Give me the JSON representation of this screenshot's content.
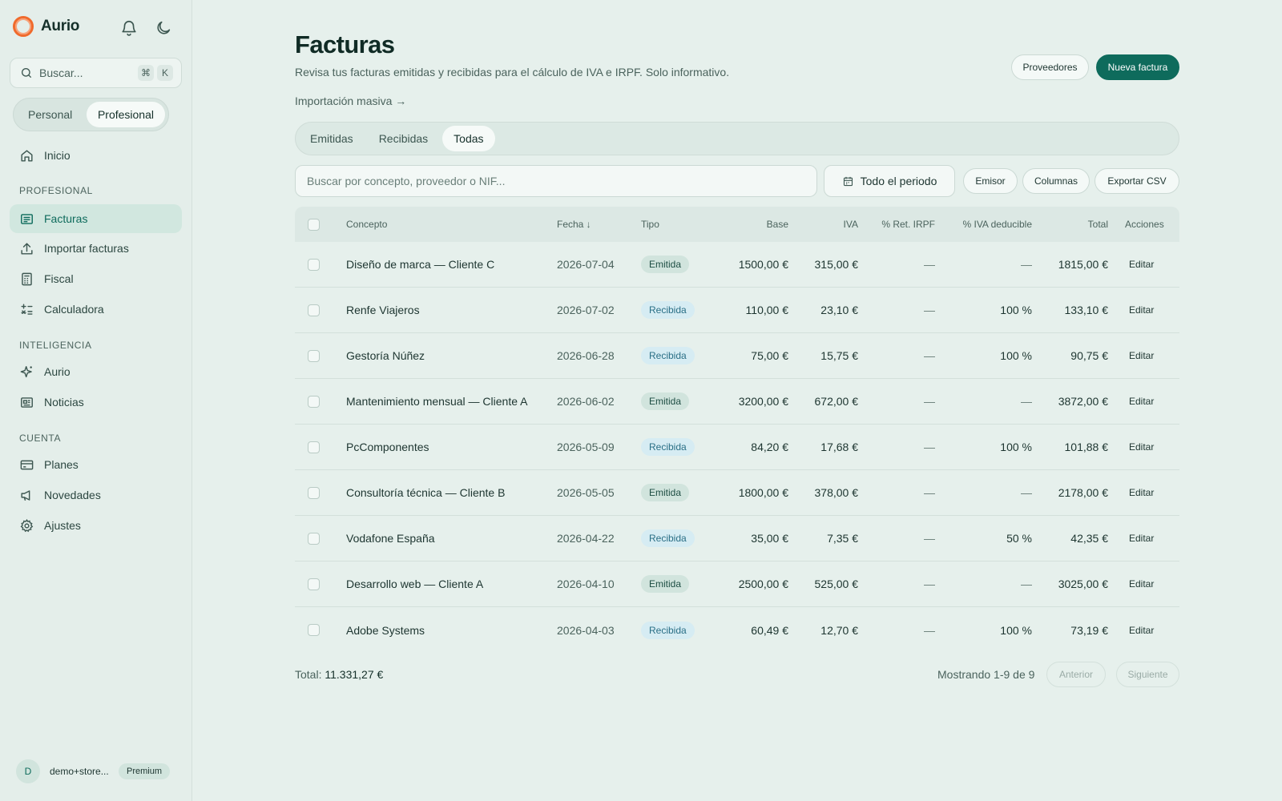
{
  "sidebar": {
    "brand": "Aurio",
    "search": {
      "placeholder": "Buscar...",
      "keys": [
        "⌘",
        "K"
      ]
    },
    "mode": {
      "options": [
        "Personal",
        "Profesional"
      ],
      "selected": "Profesional"
    },
    "home": "Inicio",
    "sections": [
      {
        "title": "PROFESIONAL",
        "items": [
          "Facturas",
          "Importar facturas",
          "Fiscal",
          "Calculadora"
        ]
      },
      {
        "title": "INTELIGENCIA",
        "items": [
          "Aurio",
          "Noticias"
        ]
      },
      {
        "title": "CUENTA",
        "items": [
          "Planes",
          "Novedades",
          "Ajustes"
        ]
      }
    ],
    "active_item": "Facturas",
    "user": {
      "initial": "D",
      "email": "demo+store...",
      "plan": "Premium"
    }
  },
  "page": {
    "title": "Facturas",
    "subtitle": "Revisa tus facturas emitidas y recibidas para el cálculo de IVA e IRPF. Solo informativo.",
    "import_link": "Importación masiva →",
    "buttons": {
      "suppliers": "Proveedores",
      "new_invoice": "Nueva factura"
    },
    "tabs": [
      "Emitidas",
      "Recibidas",
      "Todas"
    ],
    "active_tab": "Todas",
    "filters": {
      "search_placeholder": "Buscar por concepto, proveedor o NIF...",
      "period": "Todo el periodo",
      "issuer": "Emisor",
      "columns": "Columnas",
      "export": "Exportar CSV"
    }
  },
  "table": {
    "columns": [
      "Concepto",
      "Fecha ↓",
      "Tipo",
      "Base",
      "IVA",
      "% Ret. IRPF",
      "% IVA deducible",
      "Total",
      "Acciones"
    ],
    "action_label": "Editar",
    "rows": [
      {
        "concept": "Diseño de marca — Cliente C",
        "date": "2026-07-04",
        "type": "Emitida",
        "base": "1500,00 €",
        "iva": "315,00 €",
        "irpf": "—",
        "deductible": "—",
        "total": "1815,00 €"
      },
      {
        "concept": "Renfe Viajeros",
        "date": "2026-07-02",
        "type": "Recibida",
        "base": "110,00 €",
        "iva": "23,10 €",
        "irpf": "—",
        "deductible": "100 %",
        "total": "133,10 €"
      },
      {
        "concept": "Gestoría Núñez",
        "date": "2026-06-28",
        "type": "Recibida",
        "base": "75,00 €",
        "iva": "15,75 €",
        "irpf": "—",
        "deductible": "100 %",
        "total": "90,75 €"
      },
      {
        "concept": "Mantenimiento mensual — Cliente A",
        "date": "2026-06-02",
        "type": "Emitida",
        "base": "3200,00 €",
        "iva": "672,00 €",
        "irpf": "—",
        "deductible": "—",
        "total": "3872,00 €"
      },
      {
        "concept": "PcComponentes",
        "date": "2026-05-09",
        "type": "Recibida",
        "base": "84,20 €",
        "iva": "17,68 €",
        "irpf": "—",
        "deductible": "100 %",
        "total": "101,88 €"
      },
      {
        "concept": "Consultoría técnica — Cliente B",
        "date": "2026-05-05",
        "type": "Emitida",
        "base": "1800,00 €",
        "iva": "378,00 €",
        "irpf": "—",
        "deductible": "—",
        "total": "2178,00 €"
      },
      {
        "concept": "Vodafone España",
        "date": "2026-04-22",
        "type": "Recibida",
        "base": "35,00 €",
        "iva": "7,35 €",
        "irpf": "—",
        "deductible": "50 %",
        "total": "42,35 €"
      },
      {
        "concept": "Desarrollo web — Cliente A",
        "date": "2026-04-10",
        "type": "Emitida",
        "base": "2500,00 €",
        "iva": "525,00 €",
        "irpf": "—",
        "deductible": "—",
        "total": "3025,00 €"
      },
      {
        "concept": "Adobe Systems",
        "date": "2026-04-03",
        "type": "Recibida",
        "base": "60,49 €",
        "iva": "12,70 €",
        "irpf": "—",
        "deductible": "100 %",
        "total": "73,19 €"
      }
    ]
  },
  "footer": {
    "total_label": "Total:",
    "total_value": "11.331,27 €",
    "showing": "Mostrando 1-9 de 9",
    "prev": "Anterior",
    "next": "Siguiente"
  },
  "colors": {
    "accent": "#0e6b5c",
    "background": "#e6f0ec",
    "brand_logo": "#f06a2c"
  },
  "icons": {
    "top": [
      "bell-icon",
      "moon-icon"
    ],
    "nav": [
      "home-icon",
      "invoice-icon",
      "upload-icon",
      "calculator-grid-icon",
      "calculator-icon",
      "sparkle-icon",
      "newspaper-icon",
      "credit-card-icon",
      "megaphone-icon",
      "gear-icon"
    ]
  }
}
